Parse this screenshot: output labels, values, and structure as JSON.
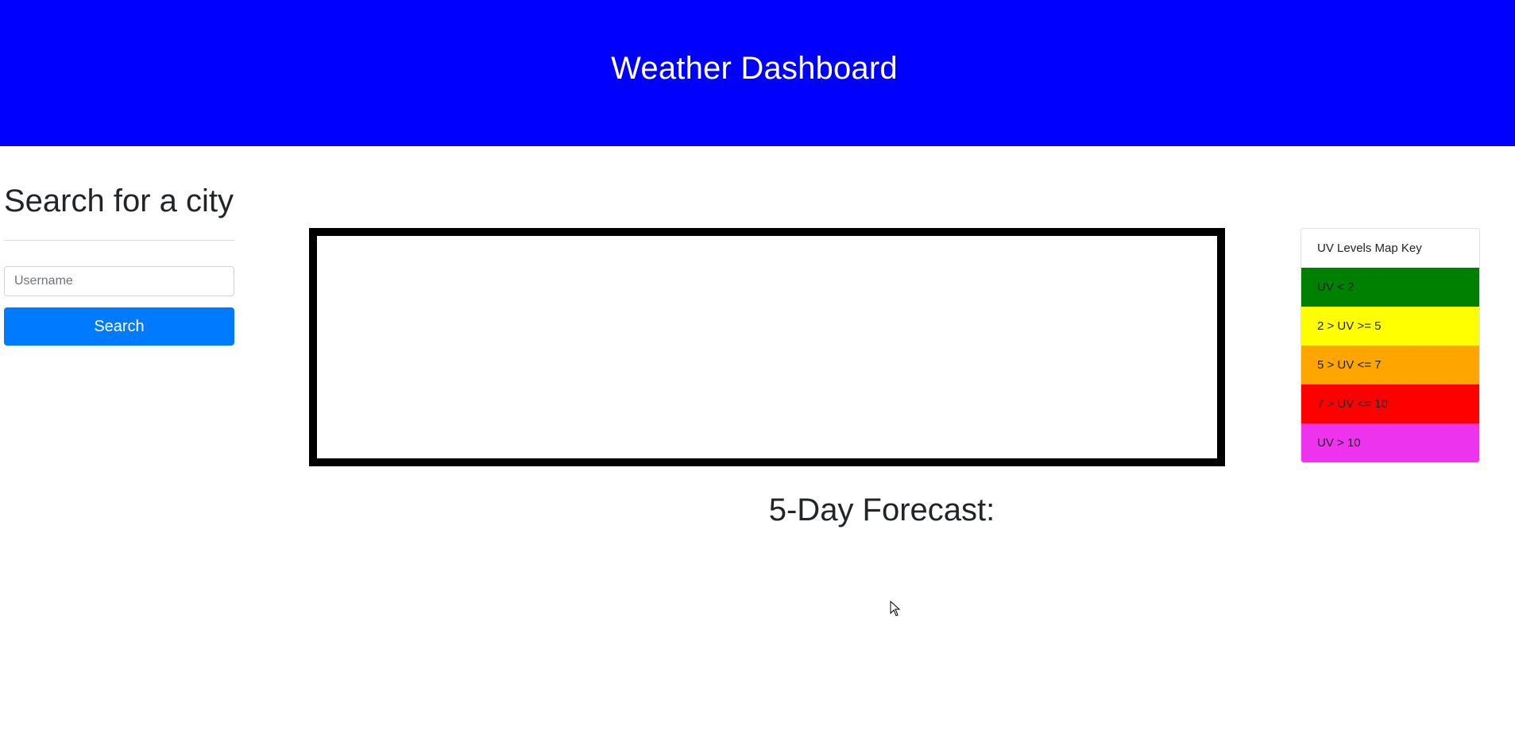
{
  "header": {
    "title": "Weather Dashboard",
    "background_color": "#0000ff"
  },
  "search": {
    "title": "Search for a city",
    "input_value": "",
    "input_placeholder": "Username",
    "button_label": "Search",
    "button_color": "#007bff"
  },
  "current_weather": {
    "border_color": "#000000"
  },
  "forecast": {
    "title": "5-Day Forecast:"
  },
  "uv_key": {
    "items": [
      {
        "label": "UV Levels Map Key",
        "color": "#ffffff"
      },
      {
        "label": "UV < 2",
        "color": "#008000"
      },
      {
        "label": "2 > UV >= 5",
        "color": "#ffff00"
      },
      {
        "label": "5 > UV <= 7",
        "color": "#ffa500"
      },
      {
        "label": "7 > UV <= 10",
        "color": "#ff0000"
      },
      {
        "label": "UV > 10",
        "color": "#ee33ee"
      }
    ]
  },
  "cursor": {
    "icon": "mouse-pointer-icon"
  }
}
